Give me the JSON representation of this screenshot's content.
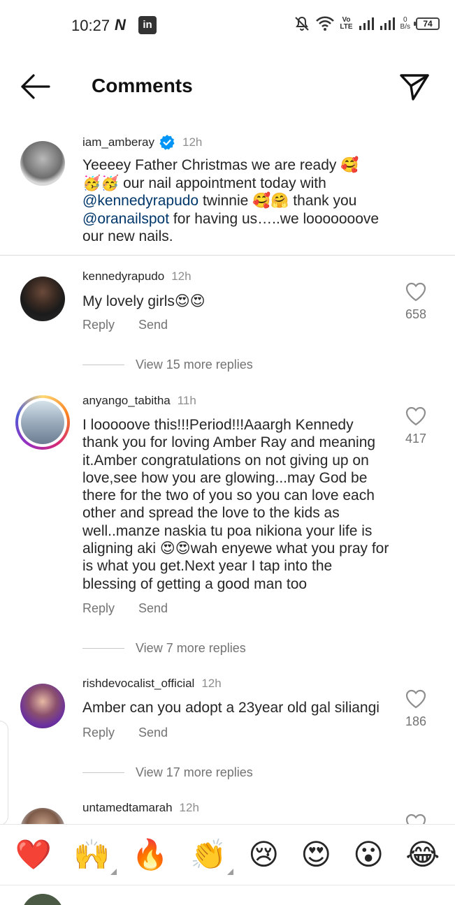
{
  "status_bar": {
    "time": "10:27",
    "notif_n": "N",
    "notif_linkedin": "in",
    "net_speed_value": "0",
    "net_speed_unit": "B/s",
    "volte": "Vo",
    "lte": "LTE",
    "battery": "74"
  },
  "header": {
    "title": "Comments"
  },
  "caption": {
    "username": "iam_amberay",
    "time": "12h",
    "text_1": "Yeeeey Father Christmas we are ready 🥰",
    "text_2": "🥳🥳 our nail appointment today with",
    "mention_1": "@kennedyrapudo",
    "text_3": " twinnie 🥰🤗 thank you",
    "mention_2": "@oranailspot",
    "text_4": " for having us…..we looooooove",
    "text_5": "our new nails."
  },
  "comments": [
    {
      "username": "kennedyrapudo",
      "time": "12h",
      "text": "My lovely girls😍😍",
      "likes": "658",
      "reply_label": "Reply",
      "send_label": "Send",
      "view_replies": "View 15 more replies"
    },
    {
      "username": "anyango_tabitha",
      "time": "11h",
      "text": "I looooove this!!!Period!!!Aaargh Kennedy thank you for loving Amber Ray and meaning it.Amber congratulations on not giving up on love,see how you are glowing...may God be there for the two of you so you can love each other and spread the love to the kids as well..manze naskia tu poa nikiona your life is aligning aki 😍😍wah enyewe what you pray for is what you get.Next year I tap into the blessing of getting a good man too",
      "likes": "417",
      "reply_label": "Reply",
      "send_label": "Send",
      "view_replies": "View 7 more replies"
    },
    {
      "username": "rishdevocalist_official",
      "time": "12h",
      "text": "Amber can you adopt a 23year old gal siliangi",
      "likes": "186",
      "reply_label": "Reply",
      "send_label": "Send",
      "view_replies": "View 17 more replies"
    },
    {
      "username": "untamedtamarah",
      "time": "12h"
    }
  ],
  "emoji_bar": [
    "❤️",
    "🙌",
    "🔥",
    "👏",
    "😢",
    "😍",
    "😮",
    "😂"
  ],
  "colors": {
    "mention": "#00376b",
    "verified": "#0095f6",
    "secondary_text": "#737373",
    "heart": "#ed4956"
  }
}
